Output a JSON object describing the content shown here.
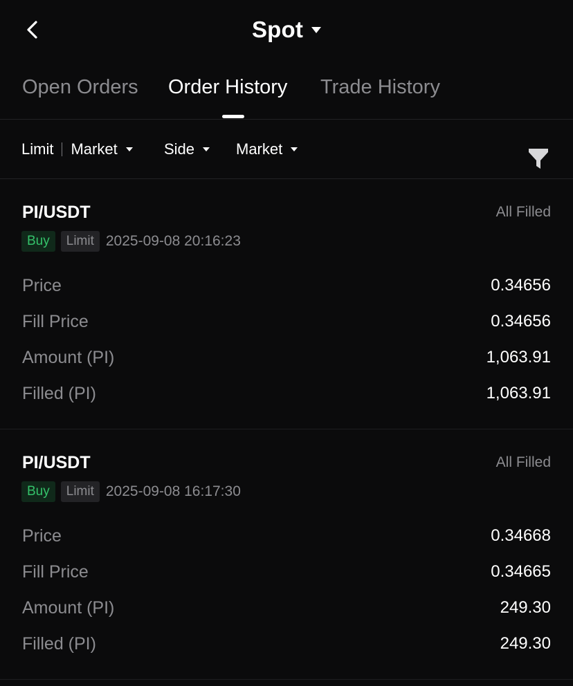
{
  "header": {
    "title": "Spot",
    "back_icon": "chevron-left-icon",
    "title_dropdown_icon": "caret-down-icon"
  },
  "tabs": [
    {
      "label": "Open Orders",
      "active": false
    },
    {
      "label": "Order History",
      "active": true
    },
    {
      "label": "Trade History",
      "active": false
    }
  ],
  "filters": {
    "order_type_left": "Limit",
    "order_type_right": "Market",
    "side": "Side",
    "market": "Market",
    "filter_icon": "funnel-icon"
  },
  "orders": [
    {
      "pair": "PI/USDT",
      "status": "All Filled",
      "side": "Buy",
      "type": "Limit",
      "time": "2025-09-08 20:16:23",
      "fields": [
        {
          "label": "Price",
          "value": "0.34656"
        },
        {
          "label": "Fill Price",
          "value": "0.34656"
        },
        {
          "label": "Amount (PI)",
          "value": "1,063.91"
        },
        {
          "label": "Filled (PI)",
          "value": "1,063.91"
        }
      ]
    },
    {
      "pair": "PI/USDT",
      "status": "All Filled",
      "side": "Buy",
      "type": "Limit",
      "time": "2025-09-08 16:17:30",
      "fields": [
        {
          "label": "Price",
          "value": "0.34668"
        },
        {
          "label": "Fill Price",
          "value": "0.34665"
        },
        {
          "label": "Amount (PI)",
          "value": "249.30"
        },
        {
          "label": "Filled (PI)",
          "value": "249.30"
        }
      ]
    }
  ],
  "colors": {
    "background": "#0b0b0c",
    "buy_green": "#34c26a",
    "muted_text": "#8c8c90"
  }
}
